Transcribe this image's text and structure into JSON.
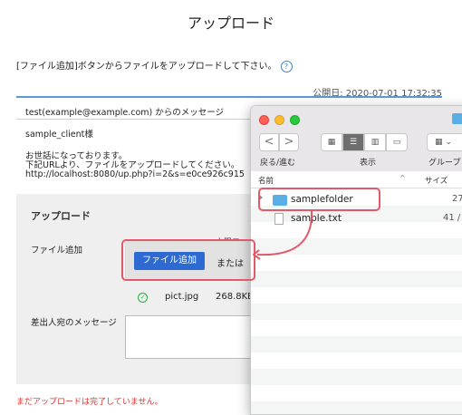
{
  "page": {
    "title": "アップロード",
    "instruction": "[ファイル追加]ボタンからファイルをアップロードして下さい。",
    "help_icon": "?",
    "published": "公開日: 2020-07-01 17:32:35"
  },
  "message": {
    "sender": "test(example@example.com) からのメッセージ",
    "client": "sample_client様",
    "body": "お世話になっております。\n下記URLより、ファイルをアップロードしてください。\nhttp://localhost:8080/up.php?i=2&s=e0ce926c915"
  },
  "upload": {
    "heading": "アップロード",
    "limit_text": "上限ファ",
    "add_file_label": "ファイル追加",
    "add_button": "ファイル追加",
    "or_text": "または",
    "file_name": "pict.jpg",
    "file_size": "268.8KB",
    "recipient_label": "差出人宛のメッセージ",
    "warning": "まだアップロードは完了していません。"
  },
  "finder": {
    "back_fwd_label": "戻る/進む",
    "view_label": "表示",
    "group_label": "グループ",
    "col_name": "名前",
    "col_sort": "^",
    "col_size": "サイズ",
    "back_glyph": "<",
    "forward_glyph": ">",
    "rows": [
      {
        "name": "samplefolder",
        "size": "27"
      },
      {
        "name": "sample.txt",
        "size": "41 /"
      }
    ]
  },
  "colors": {
    "accent": "#2d6bd3",
    "highlight": "#e05a6a",
    "folder": "#5aaee6"
  },
  "icons": [
    "help-icon",
    "check-icon",
    "folder-icon",
    "text-file-icon"
  ]
}
